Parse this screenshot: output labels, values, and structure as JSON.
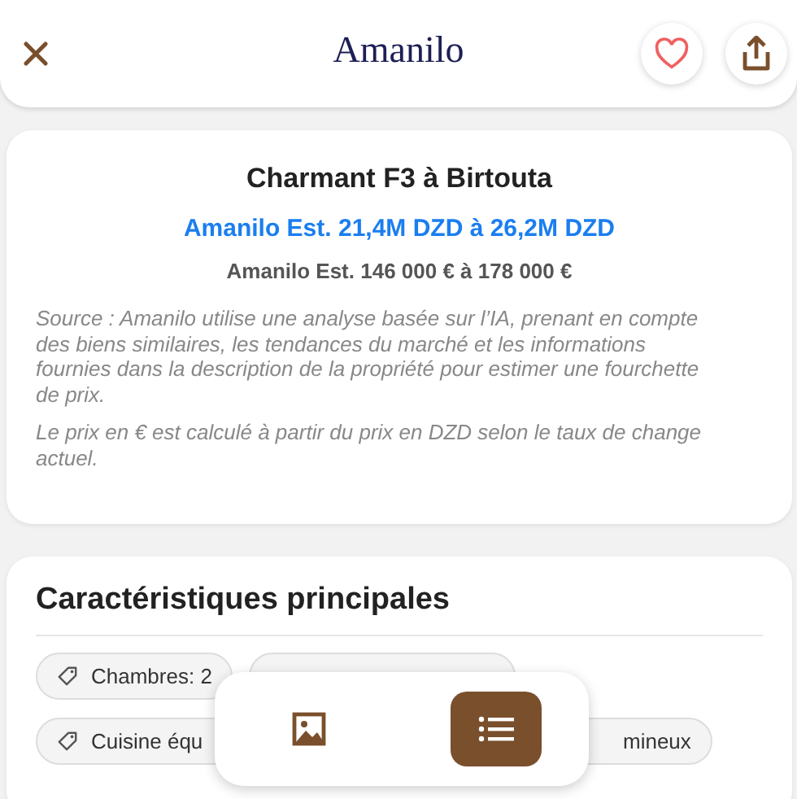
{
  "header": {
    "logo": "Amanilo",
    "favorite": false
  },
  "estimate": {
    "title": "Charmant F3 à Birtouta",
    "price_dzd": "Amanilo Est. 21,4M DZD à 26,2M DZD",
    "price_eur": "Amanilo Est. 146 000 € à 178 000 €",
    "notes": [
      "Source : Amanilo utilise une analyse basée sur l’IA, prenant en compte des biens similaires, les tendances du marché et les informations fournies dans la description de la propriété pour estimer une fourchette de prix.",
      "Le prix en € est calculé à partir du prix en DZD selon le taux de change actuel."
    ]
  },
  "features": {
    "title": "Caractéristiques principales",
    "tags": [
      [
        "Chambres: 2"
      ],
      [
        "Cuisine équ",
        "mineux"
      ]
    ]
  },
  "view_switch": [
    {
      "kind": "photos",
      "selected": false
    },
    {
      "kind": "list",
      "selected": true
    }
  ]
}
